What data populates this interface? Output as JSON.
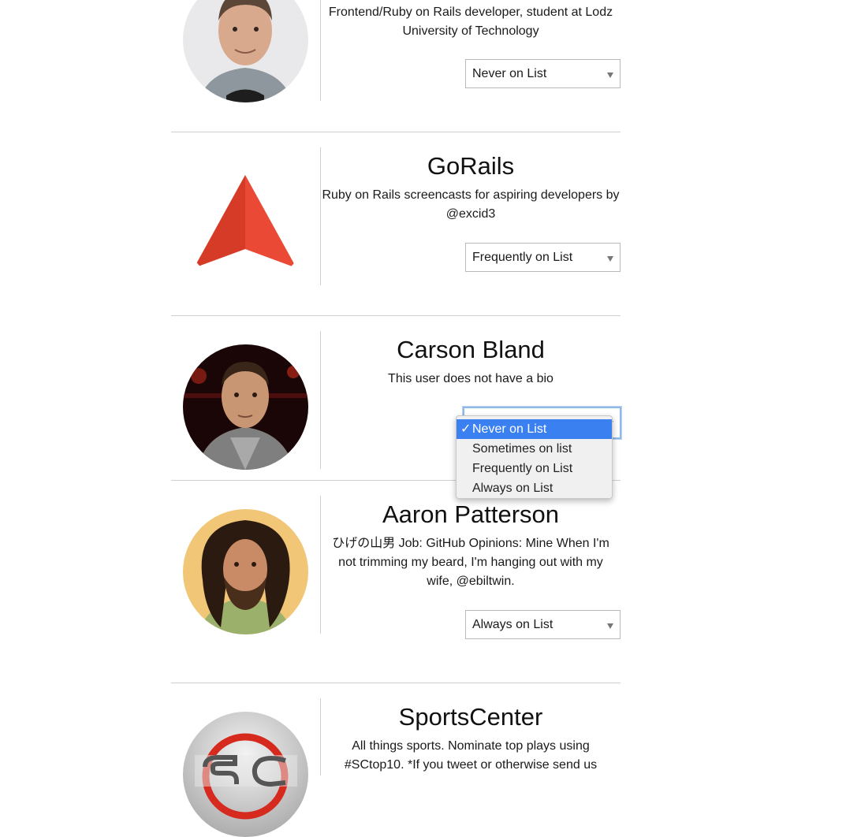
{
  "cards": [
    {
      "bio": "Frontend/Ruby on Rails developer, student at Lodz University of Technology",
      "list_status": "Never on List"
    },
    {
      "name": "GoRails",
      "bio": "Ruby on Rails screencasts for aspiring developers by @excid3",
      "list_status": "Frequently on List"
    },
    {
      "name": "Carson Bland",
      "bio": "This user does not have a bio",
      "list_status": "Never on List"
    },
    {
      "name": "Aaron Patterson",
      "bio": "ひげの山男 Job: GitHub Opinions: Mine When I'm not trimming my beard, I'm hanging out with my wife, @ebiltwin.",
      "list_status": "Always on List"
    },
    {
      "name": "SportsCenter",
      "bio": "All things sports. Nominate top plays using #SCtop10. *If you tweet or otherwise send us"
    }
  ],
  "dropdown": {
    "options": [
      "Never on List",
      "Sometimes on list",
      "Frequently on List",
      "Always on List"
    ],
    "selected": "Never on List",
    "check_mark": "✓"
  },
  "colors": {
    "highlight": "#3b80f0",
    "gorails_logo": "#e0402d",
    "separator": "#cfcfcf"
  }
}
